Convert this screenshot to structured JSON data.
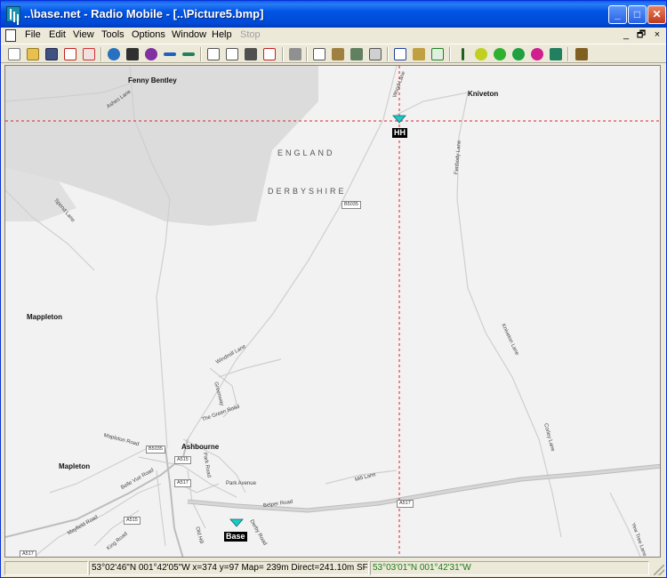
{
  "window": {
    "title": "..\\base.net - Radio Mobile - [..\\Picture5.bmp]",
    "controls": {
      "minimize": "_",
      "maximize": "□",
      "close": "✕"
    }
  },
  "menu": {
    "items": [
      "File",
      "Edit",
      "View",
      "Tools",
      "Options",
      "Window",
      "Help",
      "Stop"
    ],
    "mdi_controls": {
      "minimize": "_",
      "restore": "🗗",
      "close": "×"
    }
  },
  "toolbar": {
    "icons": [
      "new-icon",
      "open-icon",
      "save-icon",
      "network-icon",
      "properties-icon",
      "world-icon",
      "film-icon",
      "find-icon",
      "back-icon",
      "forward-icon",
      "page-icon",
      "page-out-icon",
      "image-icon",
      "pdf-icon",
      "print-icon",
      "copy-icon",
      "paste-icon",
      "merge-icon",
      "fit-icon",
      "window-icon",
      "unit-icon",
      "radio-link-icon",
      "antenna-icon",
      "coverage-icon",
      "globe-green-icon",
      "globe-blue-icon",
      "globe-red-icon",
      "terrain-icon",
      "exit-icon"
    ]
  },
  "map": {
    "places": [
      "Fenny Bentley",
      "Kniveton",
      "Mappleton",
      "Ashbourne",
      "Mapleton"
    ],
    "regions": [
      "ENGLAND",
      "DERBYSHIRE"
    ],
    "roads": [
      "Ashes Lane",
      "Wood Lane",
      "Fenbody Lane",
      "Spend Lane",
      "Windmill Lane",
      "Greenway",
      "The Green Road",
      "Mapleton Road",
      "Belle Vue Road",
      "Park Road",
      "Park Avenue",
      "Mill Lane",
      "Belper Road",
      "Mayfield Road",
      "King Road",
      "Old Hill",
      "Derby Road",
      "Kniveton Lane",
      "Corley Lane",
      "Yew Tree Lane"
    ],
    "shields": [
      "B5035",
      "B5035",
      "A515",
      "A517",
      "A517",
      "A515",
      "A517"
    ],
    "markers": [
      {
        "name": "HH",
        "color": "#1ec8c8"
      },
      {
        "name": "Base",
        "color": "#1ec8c8"
      }
    ],
    "crosshair_color": "#e02020"
  },
  "status": {
    "position": "53°02'46\"N  001°42'05\"W  x=374 y=97 Map= 239m Direct=241.10m SF",
    "cursor": "53°03'01\"N  001°42'31\"W"
  }
}
